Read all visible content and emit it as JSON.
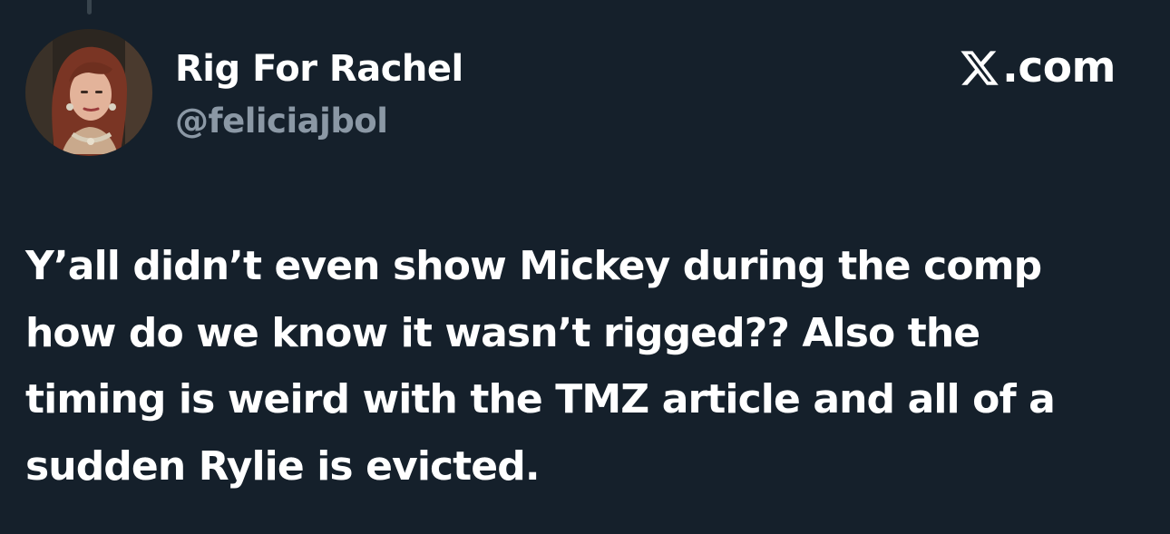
{
  "tweet": {
    "author": {
      "display_name": "Rig For Rachel",
      "handle": "@feliciajbol",
      "avatar_icon": "profile-photo"
    },
    "brand": {
      "icon": "x-logo-icon",
      "text": ".com"
    },
    "text_lines": [
      "Y’all didn’t even show Mickey during the comp",
      "how do we know it wasn’t rigged?? Also the",
      "timing is weird with the TMZ article and all of a",
      "sudden Rylie is evicted."
    ]
  },
  "colors": {
    "background": "#15202b",
    "primary_text": "#ffffff",
    "secondary_text": "#8b98a5"
  }
}
